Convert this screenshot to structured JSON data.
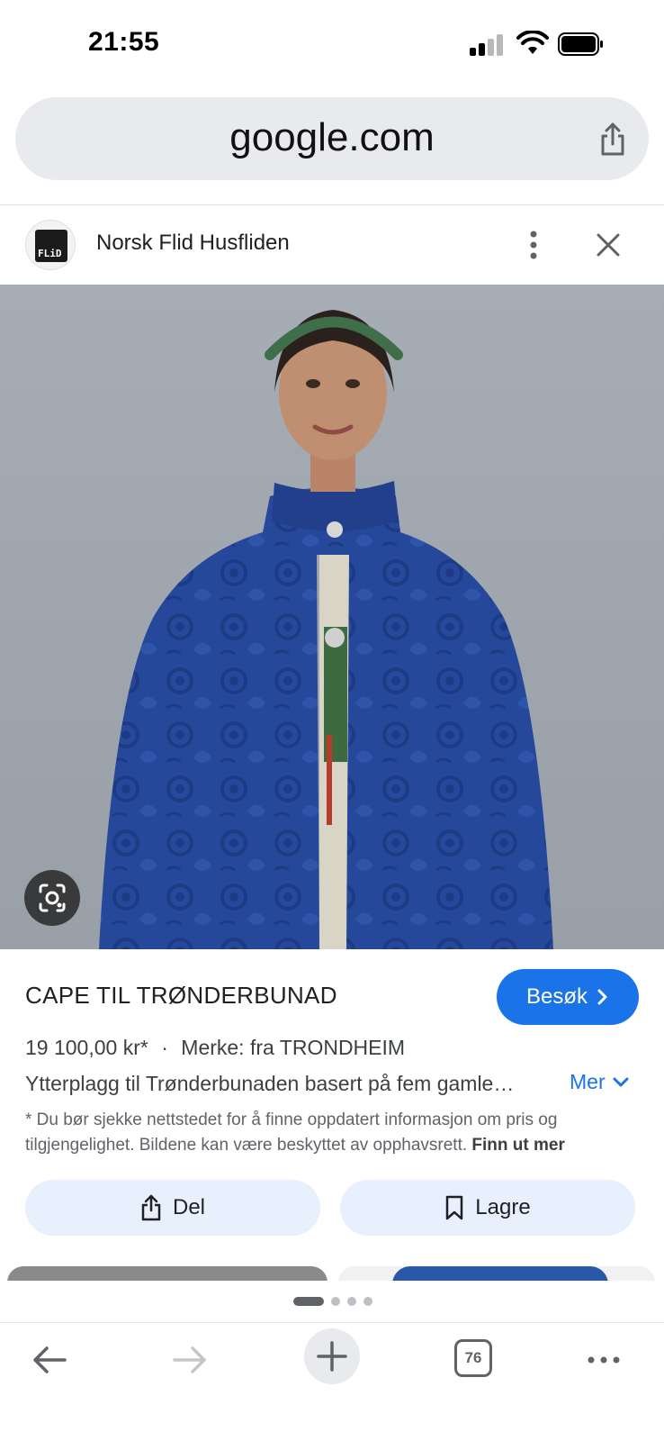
{
  "status_bar": {
    "time": "21:55"
  },
  "url_bar": {
    "domain": "google.com"
  },
  "source": {
    "name": "Norsk Flid Husfliden",
    "logo_text": "FLiD"
  },
  "product": {
    "title": "CAPE TIL TRØNDERBUNAD",
    "visit_label": "Besøk",
    "price": "19 100,00 kr*",
    "separator": "·",
    "brand": "Merke: fra TRONDHEIM",
    "description": "Ytterplagg til Trønderbunaden basert på fem gamle…",
    "more_label": "Mer",
    "disclaimer": "* Du bør sjekke nettstedet for å finne oppdatert informasjon om pris og tilgjengelighet. Bildene kan være beskyttet av opphavsrett.",
    "disclaimer_link": "Finn ut mer"
  },
  "actions": {
    "share_label": "Del",
    "save_label": "Lagre"
  },
  "pager": {
    "pages": 4,
    "active": 1
  },
  "toolbar": {
    "tab_count": "76"
  },
  "colors": {
    "accent": "#1a73e8",
    "cape_blue": "#25479a",
    "button_bg": "#e8f0fe"
  },
  "icons": [
    "share-icon",
    "more-vert-icon",
    "close-icon",
    "lens-icon",
    "chevron-right-icon",
    "chevron-down-icon",
    "bookmark-icon",
    "back-arrow-icon",
    "forward-arrow-icon",
    "plus-icon",
    "tabs-icon",
    "more-horiz-icon"
  ]
}
